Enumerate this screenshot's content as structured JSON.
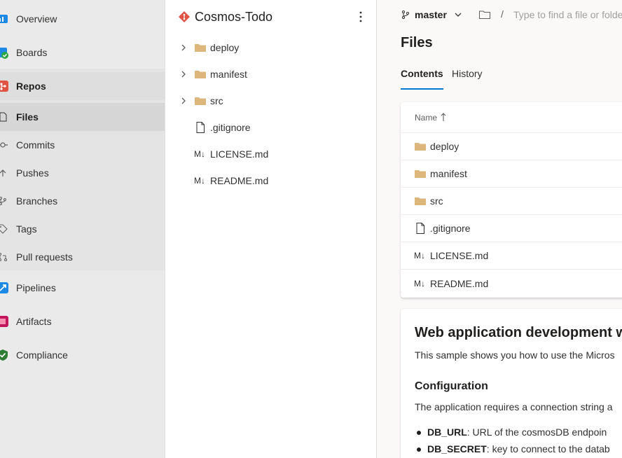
{
  "nav": {
    "items": [
      {
        "label": "Overview",
        "icon": "overview-icon"
      },
      {
        "label": "Boards",
        "icon": "boards-icon"
      },
      {
        "label": "Repos",
        "icon": "repos-icon"
      },
      {
        "label": "Files",
        "icon": "files-icon"
      },
      {
        "label": "Commits",
        "icon": "commits-icon"
      },
      {
        "label": "Pushes",
        "icon": "pushes-icon"
      },
      {
        "label": "Branches",
        "icon": "branches-icon"
      },
      {
        "label": "Tags",
        "icon": "tags-icon"
      },
      {
        "label": "Pull requests",
        "icon": "pull-requests-icon"
      },
      {
        "label": "Pipelines",
        "icon": "pipelines-icon"
      },
      {
        "label": "Artifacts",
        "icon": "artifacts-icon"
      },
      {
        "label": "Compliance",
        "icon": "compliance-icon"
      }
    ],
    "selected_section": "Repos",
    "selected_item": "Files"
  },
  "tree": {
    "repo_name": "Cosmos-Todo",
    "more_icon": "more-vertical-icon",
    "items": [
      {
        "name": "deploy",
        "type": "folder"
      },
      {
        "name": "manifest",
        "type": "folder"
      },
      {
        "name": "src",
        "type": "folder"
      },
      {
        "name": ".gitignore",
        "type": "file"
      },
      {
        "name": "LICENSE.md",
        "type": "markdown"
      },
      {
        "name": "README.md",
        "type": "markdown"
      }
    ]
  },
  "topbar": {
    "branch": "master",
    "path_separator": "/",
    "path_placeholder": "Type to find a file or folder..."
  },
  "main": {
    "title": "Files",
    "tabs": [
      {
        "label": "Contents",
        "selected": true
      },
      {
        "label": "History",
        "selected": false
      }
    ],
    "table": {
      "column_name": "Name",
      "sort": "ascending",
      "rows": [
        {
          "name": "deploy",
          "type": "folder"
        },
        {
          "name": "manifest",
          "type": "folder"
        },
        {
          "name": "src",
          "type": "folder"
        },
        {
          "name": ".gitignore",
          "type": "file"
        },
        {
          "name": "LICENSE.md",
          "type": "markdown"
        },
        {
          "name": "README.md",
          "type": "markdown"
        }
      ]
    }
  },
  "readme": {
    "title": "Web application development wit",
    "intro": "This sample shows you how to use the Micros",
    "config_heading": "Configuration",
    "config_text": "The application requires a connection string a",
    "bullets": [
      {
        "key": "DB_URL",
        "text": ": URL of the cosmosDB endpoin"
      },
      {
        "key": "DB_SECRET",
        "text": ": key to connect to the datab"
      }
    ]
  },
  "colors": {
    "accent": "#0078d4",
    "folder": "#dcb67a",
    "repo": "#e05243"
  }
}
